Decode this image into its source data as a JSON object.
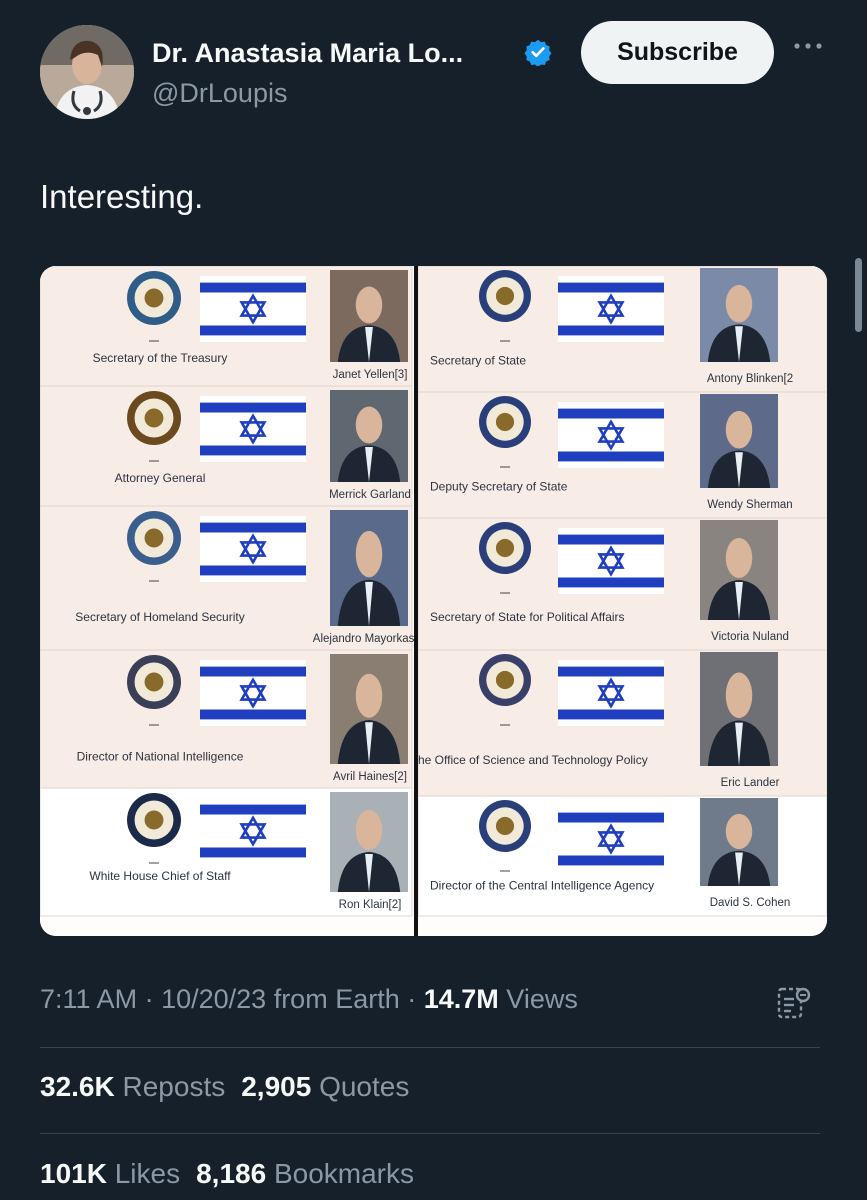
{
  "author": {
    "display_name": "Dr. Anastasia Maria Lo...",
    "handle": "@DrLoupis",
    "verified": true
  },
  "actions": {
    "subscribe_label": "Subscribe"
  },
  "tweet": {
    "text": "Interesting."
  },
  "media": {
    "left_column": [
      {
        "title": "Secretary of the Treasury",
        "caption": "Janet Yellen",
        "ref": "[3]"
      },
      {
        "title": "Attorney General",
        "caption": "Merrick Garland",
        "ref": ""
      },
      {
        "title": "Secretary of Homeland Security",
        "caption": "Alejandro Mayorkas",
        "ref": "[2]"
      },
      {
        "title": "Director of National Intelligence",
        "caption": "Avril Haines",
        "ref": "[2]"
      },
      {
        "title": "White House Chief of Staff",
        "caption": "Ron Klain",
        "ref": "[2]"
      }
    ],
    "right_column": [
      {
        "title": "Secretary of State",
        "caption": "Antony Blinken",
        "ref": "[2"
      },
      {
        "title": "Deputy Secretary of State",
        "caption": "Wendy Sherman",
        "ref": ""
      },
      {
        "title": "Secretary of State for Political Affairs",
        "caption": "Victoria Nuland",
        "ref": ""
      },
      {
        "title": "he Office of Science and Technology Policy",
        "caption": "Eric Lander",
        "ref": ""
      },
      {
        "title": "Director of the Central Intelligence Agency",
        "caption": "David S. Cohen",
        "ref": ""
      }
    ],
    "flag_colors": {
      "blue": "#1f3fbf",
      "white": "#ffffff"
    }
  },
  "meta": {
    "time": "7:11 AM",
    "date": "10/20/23",
    "source": "from Earth",
    "views_count": "14.7M",
    "views_label": "Views"
  },
  "stats": {
    "reposts_count": "32.6K",
    "reposts_label": "Reposts",
    "quotes_count": "2,905",
    "quotes_label": "Quotes",
    "likes_count": "101K",
    "likes_label": "Likes",
    "bookmarks_count": "8,186",
    "bookmarks_label": "Bookmarks"
  },
  "colors": {
    "background": "#15202b",
    "verified": "#1d9bf0",
    "muted": "#8b98a5"
  }
}
